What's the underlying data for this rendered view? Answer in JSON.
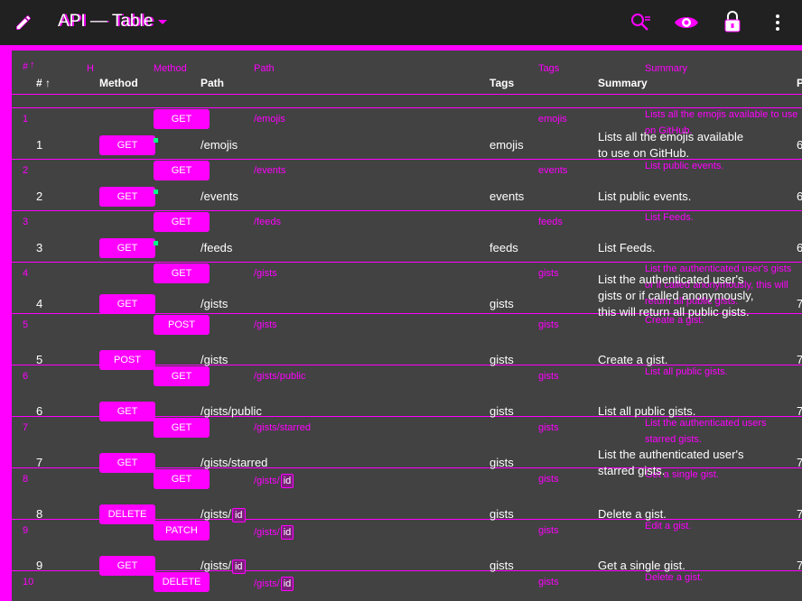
{
  "toolbar": {
    "title": "API — Table",
    "icons": [
      "edit-icon",
      "search-icon",
      "eye-icon",
      "lock-icon",
      "more-vert-icon"
    ]
  },
  "colors": {
    "accent": "#ff00ff",
    "toolbar_bg": "#212121",
    "page_bg": "#424242",
    "text": "#ffffff"
  },
  "table": {
    "headers": {
      "index": "#",
      "method": "Method",
      "path": "Path",
      "tags": "Tags",
      "summary": "Summary",
      "extra": "P"
    },
    "ghost_headers": {
      "index": "#",
      "h": "H",
      "method": "Method",
      "path": "Path",
      "tags": "Tags",
      "summary": "Summary"
    },
    "rows": [
      {
        "index": "1",
        "method": "GET",
        "path": "/emojis",
        "path_param": "",
        "tags": "emojis",
        "summary": "Lists all the emojis available to use on GitHub.",
        "extra": "6"
      },
      {
        "index": "2",
        "method": "GET",
        "path": "/events",
        "path_param": "",
        "tags": "events",
        "summary": "List public events.",
        "extra": "6"
      },
      {
        "index": "3",
        "method": "GET",
        "path": "/feeds",
        "path_param": "",
        "tags": "feeds",
        "summary": "List Feeds.",
        "extra": "6"
      },
      {
        "index": "4",
        "method": "GET",
        "path": "/gists",
        "path_param": "",
        "tags": "gists",
        "summary": "List the authenticated user's gists or if called anonymously, this will return all public gists.",
        "extra": "7"
      },
      {
        "index": "5",
        "method": "POST",
        "path": "/gists",
        "path_param": "",
        "tags": "gists",
        "summary": "Create a gist.",
        "extra": "7"
      },
      {
        "index": "6",
        "method": "GET",
        "path": "/gists/public",
        "path_param": "",
        "tags": "gists",
        "summary": "List all public gists.",
        "extra": "7"
      },
      {
        "index": "7",
        "method": "GET",
        "path": "/gists/starred",
        "path_param": "",
        "tags": "gists",
        "summary": "List the authenticated user's starred gists.",
        "extra": "7"
      },
      {
        "index": "8",
        "method": "DELETE",
        "path": "/gists/",
        "path_param": "id",
        "tags": "gists",
        "summary": "Delete a gist.",
        "extra": "7"
      },
      {
        "index": "9",
        "method": "GET",
        "path": "/gists/",
        "path_param": "id",
        "tags": "gists",
        "summary": "Get a single gist.",
        "extra": "7"
      }
    ],
    "ghost_rows": [
      {
        "index": "1",
        "method": "GET",
        "path": "/emojis",
        "path_param": "",
        "tags": "emojis",
        "summary": "Lists all the emojis available to use on GitHub."
      },
      {
        "index": "2",
        "method": "GET",
        "path": "/events",
        "path_param": "",
        "tags": "events",
        "summary": "List public events."
      },
      {
        "index": "3",
        "method": "GET",
        "path": "/feeds",
        "path_param": "",
        "tags": "feeds",
        "summary": "List Feeds."
      },
      {
        "index": "4",
        "method": "GET",
        "path": "/gists",
        "path_param": "",
        "tags": "gists",
        "summary": "List the authenticated user's gists or if called anonymously, this will return all public gists."
      },
      {
        "index": "5",
        "method": "POST",
        "path": "/gists",
        "path_param": "",
        "tags": "gists",
        "summary": "Create a gist."
      },
      {
        "index": "6",
        "method": "GET",
        "path": "/gists/public",
        "path_param": "",
        "tags": "gists",
        "summary": "List all public gists."
      },
      {
        "index": "7",
        "method": "GET",
        "path": "/gists/starred",
        "path_param": "",
        "tags": "gists",
        "summary": "List the authenticated users starred gists."
      },
      {
        "index": "8",
        "method": "GET",
        "path": "/gists/",
        "path_param": "id",
        "tags": "gists",
        "summary": "Get a single gist."
      },
      {
        "index": "9",
        "method": "PATCH",
        "path": "/gists/",
        "path_param": "id",
        "tags": "gists",
        "summary": "Edit a gist."
      },
      {
        "index": "10",
        "method": "DELETE",
        "path": "/gists/",
        "path_param": "id",
        "tags": "gists",
        "summary": "Delete a gist."
      }
    ]
  }
}
